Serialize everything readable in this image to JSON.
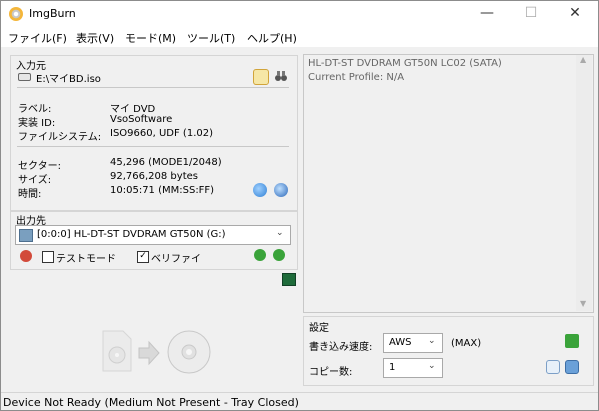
{
  "window": {
    "title": "ImgBurn",
    "minimize": "—",
    "maximize": "☐",
    "close": "✕"
  },
  "menu": [
    "ファイル(F)",
    "表示(V)",
    "モード(M)",
    "ツール(T)",
    "ヘルプ(H)"
  ],
  "source": {
    "heading": "入力元",
    "file": "E:\\マイBD.iso",
    "fields": [
      {
        "label": "ラベル:",
        "value": "マイ DVD"
      },
      {
        "label": "実装 ID:",
        "value": "VsoSoftware"
      },
      {
        "label": "ファイルシステム:",
        "value": "ISO9660, UDF (1.02)"
      }
    ],
    "stats": [
      {
        "label": "セクター:",
        "value": "45,296 (MODE1/2048)"
      },
      {
        "label": "サイズ:",
        "value": "92,766,208 bytes"
      },
      {
        "label": "時間:",
        "value": "10:05:71 (MM:SS:FF)"
      }
    ]
  },
  "destination": {
    "heading": "出力先",
    "drive": "[0:0:0] HL-DT-ST DVDRAM GT50N (G:)",
    "test_mode": "テストモード",
    "verify": "ベリファイ",
    "test_mode_checked": false,
    "verify_checked": true
  },
  "info": {
    "device": "HL-DT-ST DVDRAM GT50N LC02 (SATA)",
    "profile": "Current Profile: N/A"
  },
  "settings": {
    "heading": "設定",
    "speed_label": "書き込み速度:",
    "speed_value": "AWS",
    "speed_max": "(MAX)",
    "copies_label": "コピー数:",
    "copies_value": "1"
  },
  "status": "Device Not Ready (Medium Not Present - Tray Closed)",
  "colors": {
    "green": "#3aa33a",
    "blue": "#2f7fd4",
    "gold": "#e8b82d"
  }
}
